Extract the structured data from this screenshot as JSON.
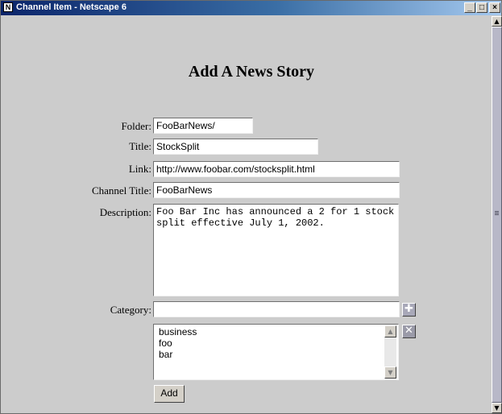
{
  "window": {
    "title": "Channel Item - Netscape 6",
    "app_icon_letter": "N",
    "minimize_glyph": "_",
    "maximize_glyph": "□",
    "close_glyph": "×"
  },
  "page": {
    "heading": "Add A News Story"
  },
  "form": {
    "folder": {
      "label": "Folder:",
      "value": "FooBarNews/"
    },
    "title": {
      "label": "Title:",
      "value": "StockSplit"
    },
    "link": {
      "label": "Link:",
      "value": "http://www.foobar.com/stocksplit.html"
    },
    "channel_title": {
      "label": "Channel Title:",
      "value": "FooBarNews"
    },
    "description": {
      "label": "Description:",
      "value": "Foo Bar Inc has announced a 2 for 1 stock split effective July 1, 2002."
    },
    "category": {
      "label": "Category:",
      "value": "",
      "options": [
        "business",
        "foo",
        "bar"
      ],
      "add_icon": "plus-icon",
      "remove_icon": "x-icon"
    },
    "add_button": "Add"
  },
  "colors": {
    "titlebar_start": "#0a246a",
    "titlebar_end": "#a6caf0",
    "background": "#cccccc"
  }
}
